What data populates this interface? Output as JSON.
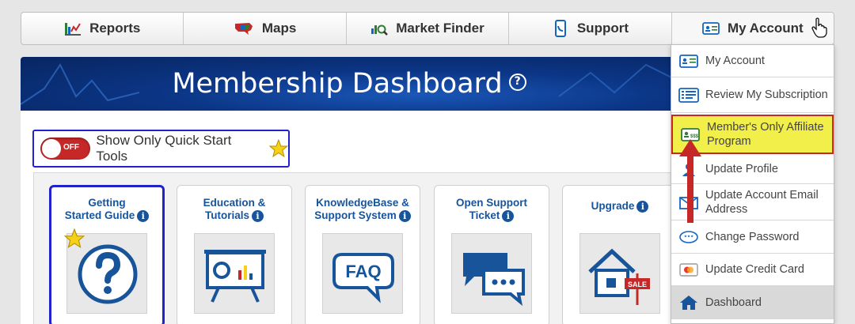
{
  "nav": {
    "reports": "Reports",
    "maps": "Maps",
    "market_finder": "Market Finder",
    "support": "Support",
    "my_account": "My Account"
  },
  "header": {
    "title": "Membership Dashboard",
    "help": "?"
  },
  "quick_start": {
    "toggle_state": "OFF",
    "label": "Show Only Quick Start Tools"
  },
  "tools": [
    {
      "title_l1": "Getting",
      "title_l2": "Started Guide",
      "icon": "question-mark-icon"
    },
    {
      "title_l1": "Education &",
      "title_l2": "Tutorials",
      "icon": "presentation-board-icon"
    },
    {
      "title_l1": "KnowledgeBase &",
      "title_l2": "Support System",
      "icon": "faq-bubble-icon"
    },
    {
      "title_l1": "Open Support",
      "title_l2": "Ticket",
      "icon": "chat-bubbles-icon"
    },
    {
      "title_l1": "Upgrade",
      "title_l2": "",
      "icon": "house-sale-icon"
    }
  ],
  "info_glyph": "i",
  "dropdown": [
    {
      "label": "My Account",
      "icon": "account-card-icon"
    },
    {
      "label": "Review My Subscription",
      "icon": "subscription-list-icon"
    },
    {
      "label": "Member's Only Affiliate Program",
      "icon": "affiliate-card-icon"
    },
    {
      "label": "Update Profile",
      "icon": "profile-icon"
    },
    {
      "label": "Update Account Email Address",
      "icon": "email-icon"
    },
    {
      "label": "Change Password",
      "icon": "password-icon"
    },
    {
      "label": "Update Credit Card",
      "icon": "credit-card-icon"
    },
    {
      "label": "Dashboard",
      "icon": "house-icon"
    }
  ],
  "colors": {
    "accent_blue": "#17549a",
    "highlight_yellow": "#f2ef4a",
    "arrow_red": "#c62828",
    "header_blue": "#0b3585"
  }
}
